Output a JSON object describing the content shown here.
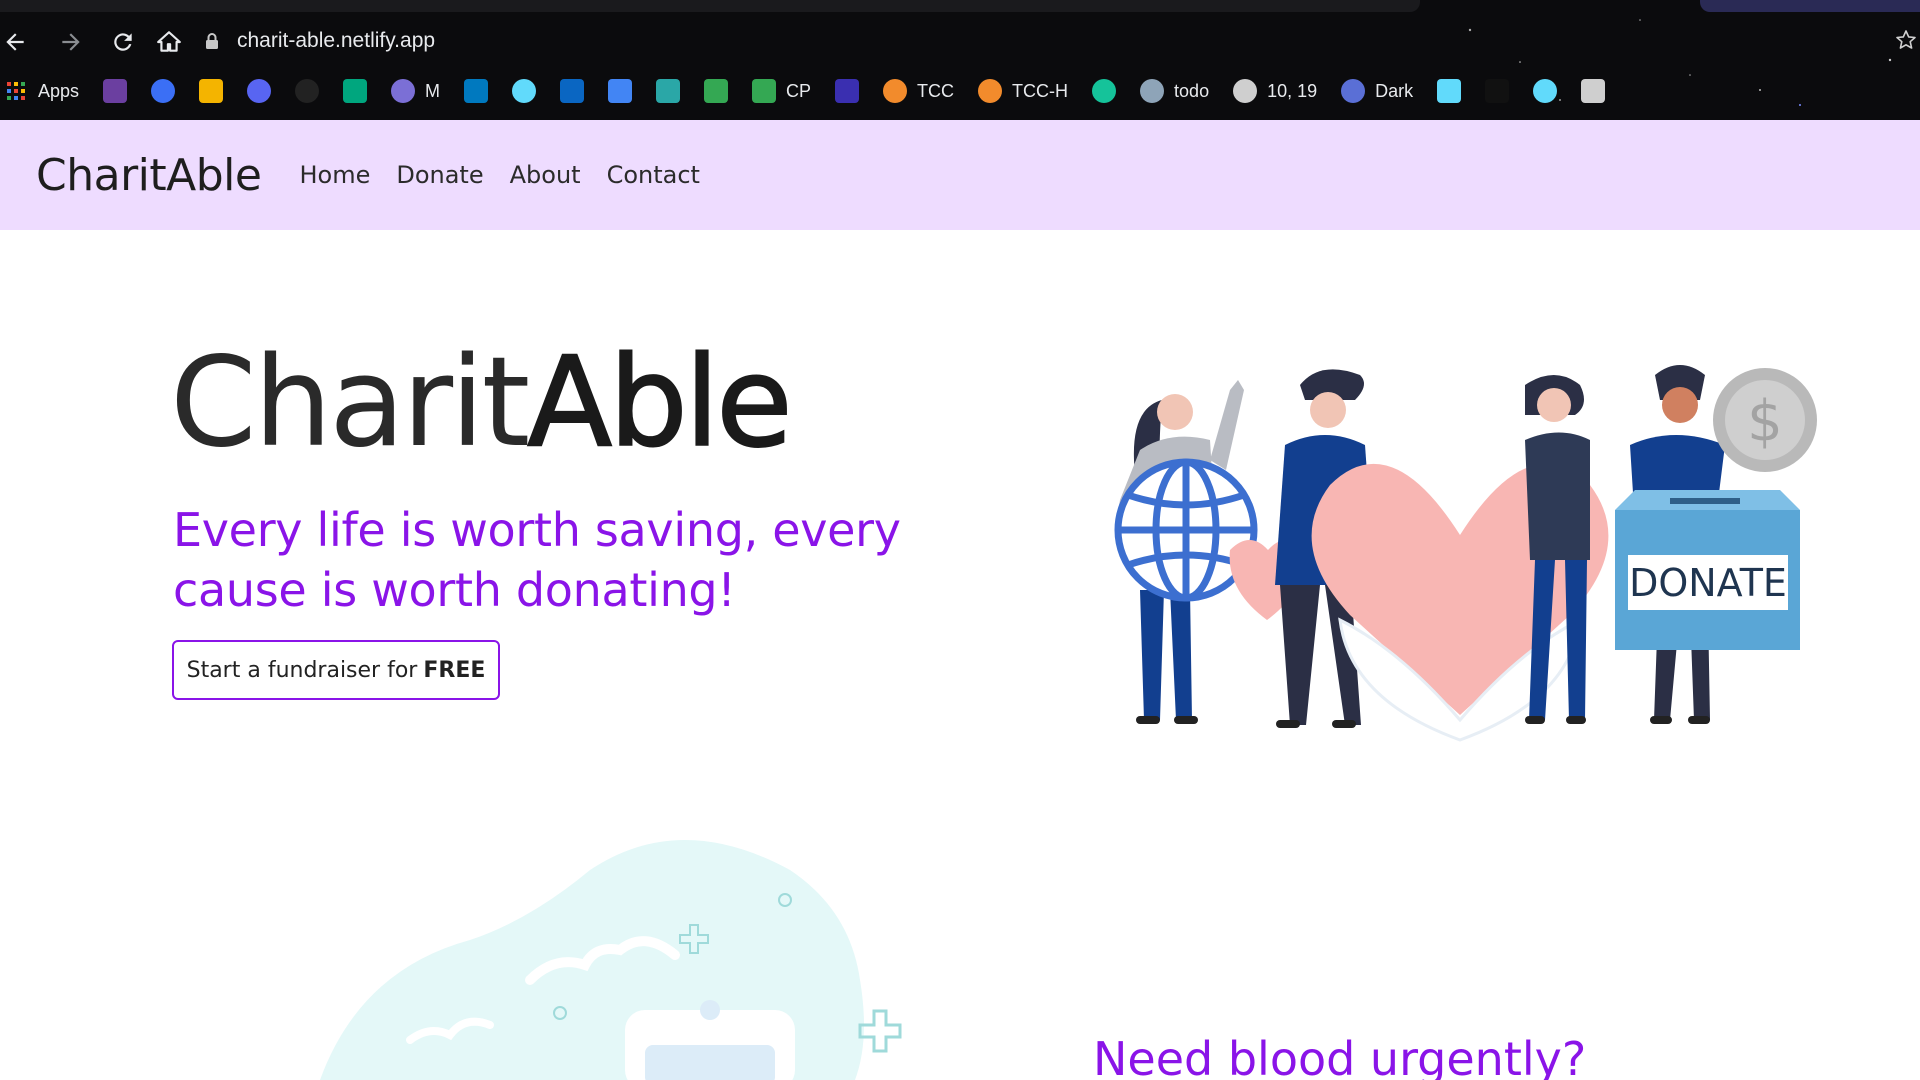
{
  "browser": {
    "url": "charit-able.netlify.app",
    "bookmarks": [
      {
        "icon": "apps-grid-icon",
        "label": "Apps",
        "color": "#e44"
      },
      {
        "icon": "bolt-icon",
        "label": "",
        "color": "#6b3fa0"
      },
      {
        "icon": "c-circle-icon",
        "label": "",
        "color": "#3b6ff5"
      },
      {
        "icon": "classroom-icon",
        "label": "",
        "color": "#f4b400"
      },
      {
        "icon": "discord-icon",
        "label": "",
        "color": "#5865f2"
      },
      {
        "icon": "github-icon",
        "label": "",
        "color": "#222222"
      },
      {
        "icon": "meet-icon",
        "label": "",
        "color": "#00a67e"
      },
      {
        "icon": "globe-icon",
        "label": "M",
        "color": "#7b6fd6"
      },
      {
        "icon": "trello-icon",
        "label": "",
        "color": "#0079bf"
      },
      {
        "icon": "react-icon",
        "label": "",
        "color": "#61dafb"
      },
      {
        "icon": "linkedin-icon",
        "label": "",
        "color": "#0a66c2"
      },
      {
        "icon": "docs-icon",
        "label": "",
        "color": "#4285f4"
      },
      {
        "icon": "mountain-icon",
        "label": "",
        "color": "#2aa7a7"
      },
      {
        "icon": "drive-icon",
        "label": "",
        "color": "#34a853"
      },
      {
        "icon": "drive-icon",
        "label": "CP",
        "color": "#34a853"
      },
      {
        "icon": "r-icon",
        "label": "",
        "color": "#3a2fb0"
      },
      {
        "icon": "tcc-icon",
        "label": "TCC",
        "color": "#f28b2c"
      },
      {
        "icon": "tcc-icon",
        "label": "TCC-H",
        "color": "#f28b2c"
      },
      {
        "icon": "grammarly-icon",
        "label": "",
        "color": "#15c39a"
      },
      {
        "icon": "react-icon",
        "label": "todo",
        "color": "#8ea4b8"
      },
      {
        "icon": "speedometer-icon",
        "label": "10, 19",
        "color": "#cfcfcf"
      },
      {
        "icon": "figma-icon",
        "label": "Dark",
        "color": "#5a6fd6"
      },
      {
        "icon": "bootstrap-icon",
        "label": "",
        "color": "#61dafb"
      },
      {
        "icon": "dev-icon",
        "label": "",
        "color": "#111111"
      },
      {
        "icon": "react-icon",
        "label": "",
        "color": "#61dafb"
      },
      {
        "icon": "lambda-icon",
        "label": "",
        "color": "#cfcfcf"
      }
    ]
  },
  "site": {
    "brand": "CharitAble",
    "nav": [
      "Home",
      "Donate",
      "About",
      "Contact"
    ],
    "hero": {
      "title_light": "Charit",
      "title_bold": "Able",
      "tagline": "Every life is worth saving, every cause is worth donating!",
      "cta_prefix": "Start a fundraiser for",
      "cta_bold": "FREE",
      "donate_box_label": "DONATE",
      "coin_symbol": "$"
    },
    "blood_section": {
      "heading": "Need blood urgently?"
    }
  },
  "colors": {
    "accent": "#8a14e8",
    "nav_bg": "#eedcff",
    "heart": "#f8b6b3",
    "navy": "#1a3f8a",
    "box": "#5aa6d6"
  }
}
